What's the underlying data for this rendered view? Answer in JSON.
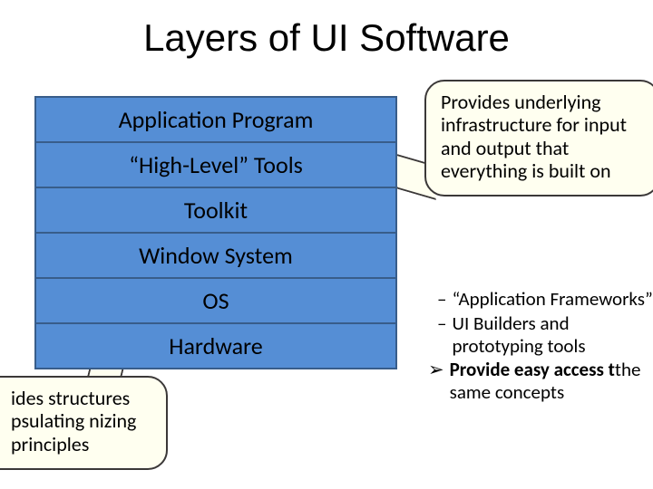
{
  "title": "Layers of UI Software",
  "layers": [
    "Application Program",
    "“High-Level” Tools",
    "Toolkit",
    "Window System",
    "OS",
    "Hardware"
  ],
  "callout_top": "Provides underlying infrastructure for input and output that everything is built on",
  "callout_bottom_left": "ides structures psulating nizing principles",
  "list": [
    {
      "bullet": "–",
      "text": "“Application Frameworks”",
      "indent": 1,
      "bold": false
    },
    {
      "bullet": "–",
      "text": "UI Builders and prototyping tools",
      "indent": 1,
      "bold": false
    },
    {
      "bullet": "➢",
      "text": "Provide easy access to the same concepts",
      "indent": 0,
      "bold": true,
      "bold_prefix": "Provide easy access t",
      "rest": "the same concepts"
    }
  ]
}
